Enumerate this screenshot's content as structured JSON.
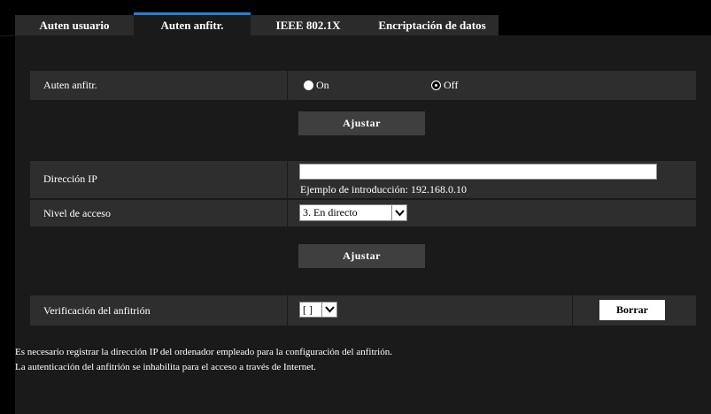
{
  "tabs": [
    {
      "label": "Auten usuario",
      "active": false
    },
    {
      "label": "Auten anfitr.",
      "active": true
    },
    {
      "label": "IEEE 802.1X",
      "active": false
    },
    {
      "label": "Encriptación de datos",
      "active": false
    }
  ],
  "host_auth": {
    "label": "Auten anfitr.",
    "options": [
      {
        "label": "On",
        "selected": true
      },
      {
        "label": "Off",
        "selected": false
      }
    ],
    "apply_label": "Ajustar"
  },
  "ip_section": {
    "ip_label": "Dirección IP",
    "ip_value": "",
    "ip_hint": "Ejemplo de introducción: 192.168.0.10",
    "access_label": "Nivel de acceso",
    "access_value": "3. En directo",
    "apply_label": "Ajustar"
  },
  "verify": {
    "label": "Verificación del anfitrión",
    "value": "[ ]",
    "delete_label": "Borrar"
  },
  "notes": [
    "Es necesario registrar la dirección IP del ordenador empleado para la configuración del anfitrión.",
    "La autenticación del anfitrión se inhabilita para el acceso a través de Internet."
  ],
  "colors": {
    "background": "#000000",
    "panel": "#1a1a1a",
    "row": "#2e2e2e",
    "button": "#3f3f3f",
    "active_tab_accent": "#2a7fd0"
  },
  "icons": {
    "select_arrow": "chevron-down-icon"
  }
}
